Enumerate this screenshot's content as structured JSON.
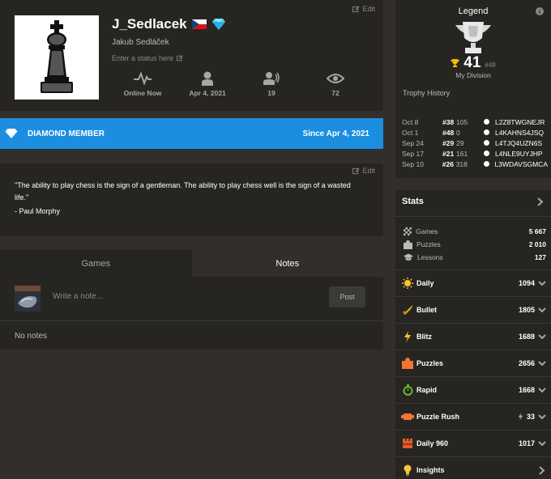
{
  "profile": {
    "username": "J_Sedlacek",
    "real_name": "Jakub Sedláček",
    "status_placeholder": "Enter a status here",
    "edit_label": "Edit",
    "stats": [
      {
        "icon": "activity-icon",
        "value": "Online Now"
      },
      {
        "icon": "person-icon",
        "value": "Apr 4, 2021"
      },
      {
        "icon": "friends-icon",
        "value": "19"
      },
      {
        "icon": "eye-icon",
        "value": "72"
      }
    ]
  },
  "diamond": {
    "label": "DIAMOND MEMBER",
    "since": "Since Apr 4, 2021"
  },
  "quote": {
    "edit_label": "Edit",
    "text": "\"The ability to play chess is the sign of a gentleman. The ability to play chess well is the sign of a wasted life.\"",
    "author": "- Paul Morphy"
  },
  "tabs": {
    "games": "Games",
    "notes": "Notes"
  },
  "notes": {
    "placeholder": "Write a note...",
    "post": "Post",
    "empty": "No notes"
  },
  "legend": {
    "title": "Legend",
    "rank": "41",
    "rank_sub": "#48",
    "division": "My Division",
    "history_title": "Trophy History",
    "history": [
      {
        "date": "Oct 8",
        "rank": "#38",
        "points": "105",
        "code": "L2Z8TWGNEJR"
      },
      {
        "date": "Oct 1",
        "rank": "#48",
        "points": "0",
        "code": "L4KAHNS4JSQ"
      },
      {
        "date": "Sep 24",
        "rank": "#29",
        "points": "29",
        "code": "L4TJQ4UZN6S"
      },
      {
        "date": "Sep 17",
        "rank": "#21",
        "points": "161",
        "code": "L4NLE9UYJHP"
      },
      {
        "date": "Sep 10",
        "rank": "#26",
        "points": "318",
        "code": "L3WDAVSGMCA"
      }
    ]
  },
  "stats": {
    "title": "Stats",
    "totals": [
      {
        "icon": "board-icon",
        "label": "Games",
        "value": "5 667"
      },
      {
        "icon": "puzzle-icon",
        "label": "Puzzles",
        "value": "2 010"
      },
      {
        "icon": "grad-cap-icon",
        "label": "Lessons",
        "value": "127"
      }
    ],
    "modes": [
      {
        "icon": "sun-icon",
        "label": "Daily",
        "value": "1094"
      },
      {
        "icon": "bullet-icon",
        "label": "Bullet",
        "value": "1805"
      },
      {
        "icon": "lightning-icon",
        "label": "Blitz",
        "value": "1688"
      },
      {
        "icon": "puzzle-piece-icon",
        "label": "Puzzles",
        "value": "2656"
      },
      {
        "icon": "stopwatch-icon",
        "label": "Rapid",
        "value": "1668"
      },
      {
        "icon": "puzzle-rush-icon",
        "label": "Puzzle Rush",
        "value": "33"
      },
      {
        "icon": "daily960-icon",
        "label": "Daily 960",
        "value": "1017"
      },
      {
        "icon": "bulb-icon",
        "label": "Insights",
        "value": ""
      }
    ]
  }
}
